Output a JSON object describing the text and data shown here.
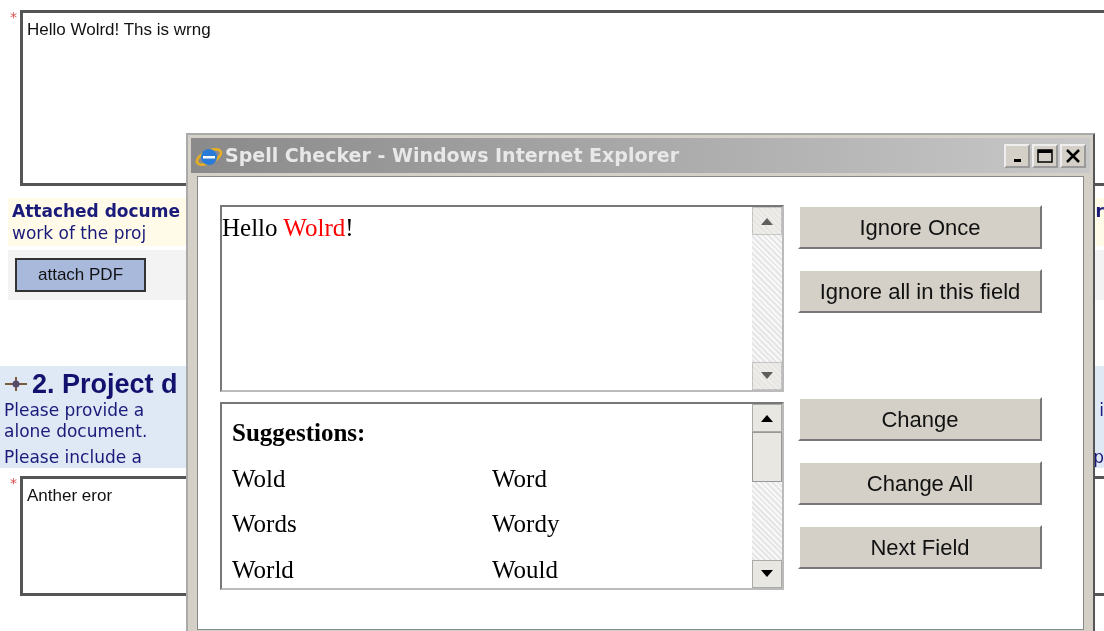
{
  "background": {
    "first_field": {
      "marker": "*",
      "value": "Hello Wolrd! Ths is wrng"
    },
    "attachment_notice": {
      "title": "Attached docume",
      "text": "work of the proj",
      "edge": "r"
    },
    "attach_button": "attach PDF",
    "section": {
      "heading": "2. Project d",
      "lines": [
        {
          "text": "Please provide a",
          "edge": "i"
        },
        {
          "text": "alone document."
        },
        {
          "text": "Please include a",
          "edge": "p"
        }
      ]
    },
    "second_field": {
      "marker": "*",
      "value": "Anther eror"
    }
  },
  "dialog": {
    "title": "Spell Checker - Windows Internet Explorer",
    "context": [
      {
        "text": "Hello ",
        "misspelled": false
      },
      {
        "text": "Wolrd",
        "misspelled": true
      },
      {
        "text": "!",
        "misspelled": false
      }
    ],
    "suggestions_label": "Suggestions:",
    "suggestions": [
      "Wold",
      "Word",
      "Words",
      "Wordy",
      "World",
      "Would"
    ],
    "buttons_top": [
      "Ignore Once",
      "Ignore all in this field"
    ],
    "buttons_bottom": [
      "Change",
      "Change All",
      "Next Field"
    ]
  }
}
